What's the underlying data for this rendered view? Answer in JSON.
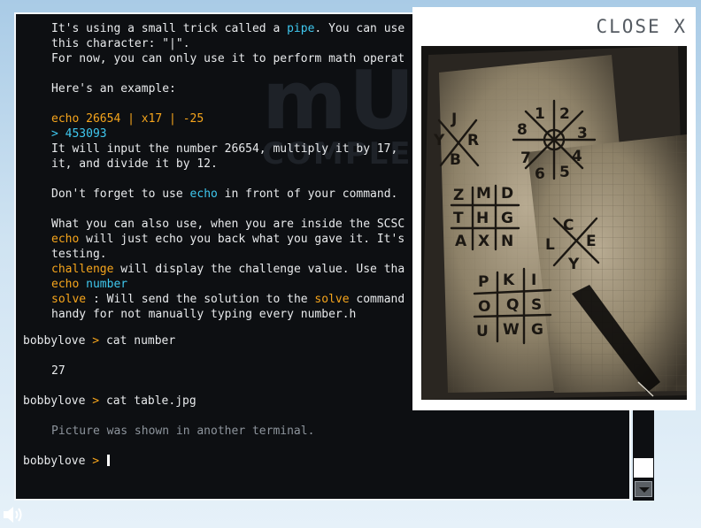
{
  "terminal": {
    "watermark_big": "mU",
    "watermark_small": "COMPLE",
    "lines": [
      [
        {
          "t": "It's using a small trick called a ",
          "cls": ""
        },
        {
          "t": "pipe",
          "cls": "c"
        },
        {
          "t": ". You can use",
          "cls": ""
        }
      ],
      [
        {
          "t": "this character: \"|\".",
          "cls": ""
        }
      ],
      [
        {
          "t": "For now, you can only use it to perform math operat",
          "cls": ""
        }
      ],
      [
        {
          "t": "",
          "cls": ""
        }
      ],
      [
        {
          "t": "Here's an example:",
          "cls": ""
        }
      ],
      [
        {
          "t": "",
          "cls": ""
        }
      ],
      [
        {
          "t": "echo 26654 | x17 | -25",
          "cls": "y"
        }
      ],
      [
        {
          "t": "> 453093",
          "cls": "c"
        }
      ],
      [
        {
          "t": "It will input the number 26654, multiply it by 17,",
          "cls": ""
        }
      ],
      [
        {
          "t": "it, and divide it by 12.",
          "cls": ""
        }
      ],
      [
        {
          "t": "",
          "cls": ""
        }
      ],
      [
        {
          "t": "Don't forget to use ",
          "cls": ""
        },
        {
          "t": "echo",
          "cls": "c"
        },
        {
          "t": " in front of your command.",
          "cls": ""
        }
      ],
      [
        {
          "t": "",
          "cls": ""
        }
      ],
      [
        {
          "t": "What you can also use, when you are inside the SCSC",
          "cls": ""
        }
      ],
      [
        {
          "t": "echo",
          "cls": "y"
        },
        {
          "t": " will just echo you back what you gave it. It's",
          "cls": ""
        }
      ],
      [
        {
          "t": "testing.",
          "cls": ""
        }
      ],
      [
        {
          "t": "challenge",
          "cls": "y"
        },
        {
          "t": " will display the challenge value. Use tha",
          "cls": ""
        }
      ],
      [
        {
          "t": "echo ",
          "cls": "y"
        },
        {
          "t": "number",
          "cls": "c"
        }
      ],
      [
        {
          "t": "solve",
          "cls": "y"
        },
        {
          "t": " : Will send the solution to the ",
          "cls": ""
        },
        {
          "t": "solve",
          "cls": "y"
        },
        {
          "t": " command",
          "cls": ""
        }
      ],
      [
        {
          "t": "handy for not manually typing every number.h",
          "cls": ""
        }
      ]
    ],
    "prompt_user": "bobbylove",
    "prompt_symbol": ">",
    "cmd1": "cat number",
    "out1": "27",
    "cmd2": "cat table.jpg",
    "out2": "Picture was shown in another terminal."
  },
  "overlay": {
    "close_label": "CLOSE X",
    "image_alt": "Pigpen cipher grid drawn on worn paper"
  },
  "colors": {
    "accent_yellow": "#f6a51c",
    "accent_cyan": "#3fc8ef",
    "terminal_bg": "#0d0f12"
  },
  "icons": [
    "speaker-icon",
    "chevron-down-icon"
  ]
}
